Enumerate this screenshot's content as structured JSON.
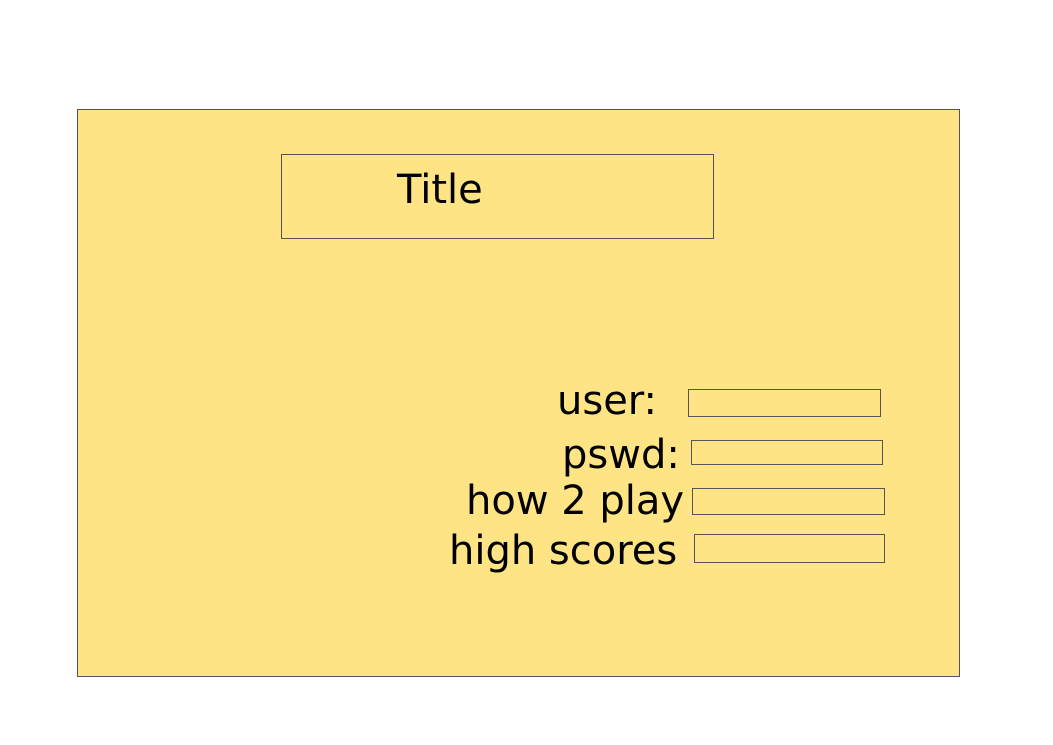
{
  "title": "Title",
  "form": {
    "user_label": "user:",
    "password_label": "pswd:",
    "how_to_play_label": "how 2 play",
    "high_scores_label": "high scores"
  },
  "colors": {
    "panel_fill": "#ffe485",
    "outline": "#555555"
  }
}
